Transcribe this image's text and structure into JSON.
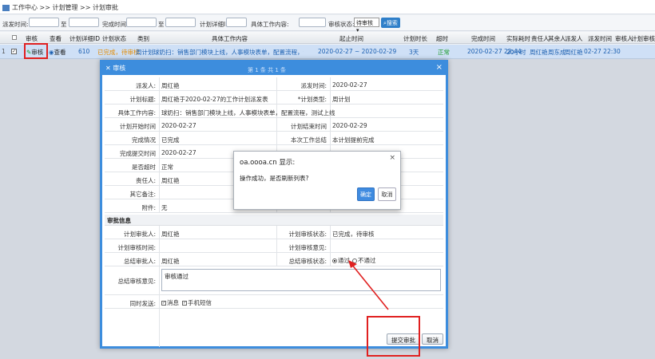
{
  "breadcrumb": "工作中心 >> 计划管理 >> 计划审批",
  "filter": {
    "dispatch_time": "派发时间:",
    "to": "至",
    "complete_time": "完成时间:",
    "detail_id": "计划详细ID:",
    "work_content": "具体工作内容:",
    "audit_status": "审核状态:",
    "audit_value": "待审核",
    "search": "搜索"
  },
  "grid": {
    "headers": [
      "审核",
      "查看",
      "计划详细ID",
      "计划状态",
      "类别",
      "具体工作内容",
      "起止时间",
      "计划时长",
      "超时",
      "完成时间",
      "实际耗时",
      "责任人",
      "其余人",
      "派发人",
      "派发时间",
      "审核人",
      "计划审核时"
    ],
    "row": {
      "audit": "审核",
      "view": "查看",
      "id": "610",
      "status": "已完成，待审核",
      "category": "周计划",
      "content": "球奶扫：销售部门模块上线，人事模块表单，配置流程，测试上线",
      "range": "2020-02-27 ~ 2020-02-29",
      "duration": "3天",
      "overtime": "正常",
      "complete": "2020-02-27 22:44",
      "cost": "20小时",
      "owner": "周红艳",
      "others": "周东成",
      "dispatcher": "周红艳",
      "dispatch_time": "02-27 22:30"
    }
  },
  "dialog": {
    "title": "审核",
    "pager": "第 1 条 共 1 条",
    "fields": {
      "dispatcher_l": "派发人:",
      "dispatcher_v": "周红艳",
      "dispatch_time_l": "派发时间:",
      "dispatch_time_v": "2020-02-27",
      "plan_title_l": "计划标题:",
      "plan_title_v": "周红艳于2020-02-27的工作计划派发表",
      "plan_type_l": "*计划类型:",
      "plan_type_v": "周计划",
      "content_l": "具体工作内容:",
      "content_v": "球奶扫：销售部门模块上线，人事模块表单，配置流程，测试上线",
      "start_l": "计划开始时间",
      "start_v": "2020-02-27",
      "end_l": "计划结束时间",
      "end_v": "2020-02-29",
      "status_l": "完成情况",
      "status_v": "已完成",
      "summary_l": "本次工作总结",
      "summary_v": "本计划提前完成",
      "submit_l": "完成提交时间",
      "submit_v": "2020-02-27",
      "ontime_l": "是否超时",
      "ontime_v": "正常",
      "owner_l": "责任人:",
      "owner_v": "周红艳",
      "remark_l": "其它备注:",
      "remark_v": "",
      "attach_l": "附件:",
      "attach_v": "无"
    },
    "section": "审批信息",
    "audit": {
      "plan_auditor_l": "计划审批人:",
      "plan_auditor_v": "周红艳",
      "plan_status_l": "计划审核状态:",
      "plan_status_v": "已完成，待审核",
      "plan_time_l": "计划审核时间:",
      "plan_opinion_l": "计划审核意见:",
      "sum_auditor_l": "总结审批人:",
      "sum_auditor_v": "周红艳",
      "sum_status_l": "总结审核状态:",
      "opt_pass": "通过",
      "opt_fail": "不通过",
      "sum_opinion_l": "总结审核意见:",
      "sum_opinion_v": "审核通过",
      "notify_l": "同时发送:",
      "notify_msg": "消息",
      "notify_sms": "手机短信"
    },
    "submit": "提交审批",
    "cancel": "取消"
  },
  "alert": {
    "title": "oa.oooa.cn 显示:",
    "message": "操作成功，是否刷新列表?",
    "ok": "确定",
    "cancel": "取消",
    "close": "×"
  },
  "colors": {
    "accent": "#3d8ddd",
    "red_mark": "#e02020"
  }
}
